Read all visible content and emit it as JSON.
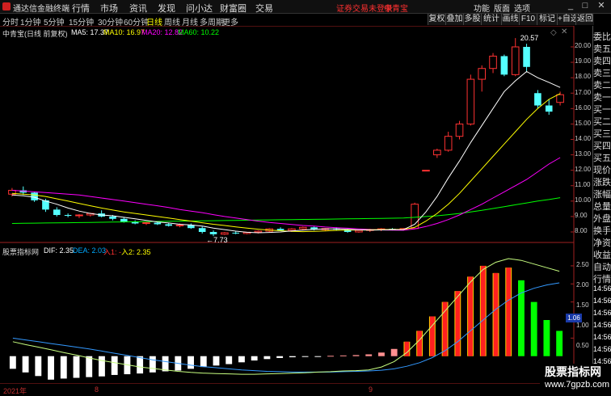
{
  "titlebar": {
    "app_title": "通达信金融终端",
    "menus": [
      "行情",
      "市场",
      "资讯",
      "发现",
      "问小达",
      "财富圈",
      "交易"
    ],
    "login_notice": "证券交易未登录",
    "stock_name": "中青宝",
    "right_items": [
      "功能",
      "版面",
      "选项"
    ],
    "window_buttons": [
      "_",
      "□",
      "✕"
    ]
  },
  "toolbar": {
    "periods": [
      "分时",
      "1分钟",
      "5分钟",
      "15分钟",
      "30分钟",
      "60分钟",
      "日线",
      "周线",
      "月线",
      "多周期",
      "更多"
    ],
    "active_period": "日线",
    "right_buttons": [
      "复权",
      "叠加",
      "多股",
      "统计",
      "画线",
      "F10",
      "标记",
      "+自选",
      "返回"
    ]
  },
  "main_chart": {
    "header_name": "中青宝(日线 前复权)",
    "ma_labels": [
      {
        "text": "MA5: 17.37",
        "color": "#ffffff"
      },
      {
        "text": "MA10: 16.97",
        "color": "#ffff00"
      },
      {
        "text": "MA20: 12.82",
        "color": "#ff00ff"
      },
      {
        "text": "MA60: 10.22",
        "color": "#00ff00"
      }
    ],
    "high_marker": "20.57",
    "low_marker": "7.73",
    "price_ticks": [
      "20.00",
      "19.00",
      "18.00",
      "17.00",
      "16.00",
      "15.00",
      "14.00",
      "13.00",
      "12.00",
      "11.00",
      "10.00",
      "9.00",
      "8.00"
    ],
    "candles": [
      [
        10.45,
        10.85,
        10.3,
        10.7
      ],
      [
        10.7,
        10.95,
        10.4,
        10.55
      ],
      [
        10.55,
        10.6,
        9.95,
        10.05
      ],
      [
        10.05,
        10.15,
        9.3,
        9.45
      ],
      [
        9.45,
        9.6,
        9.0,
        9.1
      ],
      [
        9.1,
        9.2,
        8.95,
        9.05
      ],
      [
        9.05,
        9.15,
        8.9,
        9.1
      ],
      [
        9.1,
        9.25,
        9.0,
        9.2
      ],
      [
        9.2,
        9.4,
        8.95,
        9.0
      ],
      [
        9.0,
        9.1,
        8.75,
        8.85
      ],
      [
        8.85,
        8.95,
        8.6,
        8.65
      ],
      [
        8.65,
        8.75,
        8.5,
        8.55
      ],
      [
        8.55,
        8.65,
        8.45,
        8.6
      ],
      [
        8.6,
        8.7,
        8.45,
        8.5
      ],
      [
        8.5,
        8.6,
        8.35,
        8.4
      ],
      [
        8.4,
        8.55,
        8.3,
        8.45
      ],
      [
        8.45,
        8.55,
        8.2,
        8.25
      ],
      [
        8.25,
        8.35,
        7.9,
        8.0
      ],
      [
        8.0,
        8.1,
        7.73,
        7.85
      ],
      [
        7.85,
        8.0,
        7.8,
        7.95
      ],
      [
        7.95,
        8.05,
        7.85,
        7.9
      ],
      [
        7.9,
        8.0,
        7.85,
        7.98
      ],
      [
        7.98,
        8.1,
        7.9,
        8.05
      ],
      [
        8.05,
        8.25,
        8.0,
        8.2
      ],
      [
        8.2,
        8.3,
        8.05,
        8.1
      ],
      [
        8.1,
        8.25,
        8.0,
        8.2
      ],
      [
        8.2,
        8.35,
        8.1,
        8.3
      ],
      [
        8.3,
        8.35,
        8.1,
        8.15
      ],
      [
        8.15,
        8.25,
        8.05,
        8.22
      ],
      [
        8.22,
        8.3,
        8.1,
        8.15
      ],
      [
        8.15,
        8.2,
        7.95,
        8.0
      ],
      [
        8.0,
        8.15,
        7.95,
        8.1
      ],
      [
        8.1,
        8.2,
        8.0,
        8.15
      ],
      [
        8.15,
        8.25,
        8.05,
        8.2
      ],
      [
        8.2,
        8.25,
        8.1,
        8.15
      ],
      [
        8.15,
        8.25,
        8.1,
        8.22
      ],
      [
        8.22,
        9.9,
        8.2,
        9.8
      ],
      [
        12.0,
        12.0,
        12.0,
        12.0
      ],
      [
        13.0,
        13.4,
        12.8,
        13.3
      ],
      [
        13.3,
        14.5,
        13.2,
        14.2
      ],
      [
        14.2,
        15.2,
        14.0,
        15.0
      ],
      [
        15.0,
        18.2,
        14.9,
        17.9
      ],
      [
        17.9,
        18.8,
        17.1,
        18.6
      ],
      [
        18.6,
        19.6,
        18.3,
        19.4
      ],
      [
        19.4,
        19.5,
        18.1,
        18.2
      ],
      [
        18.2,
        20.57,
        18.1,
        20.0
      ],
      [
        20.0,
        20.2,
        18.4,
        18.7
      ],
      [
        17.0,
        17.2,
        16.0,
        16.2
      ],
      [
        16.2,
        16.6,
        15.6,
        15.8
      ],
      [
        16.4,
        17.1,
        16.2,
        16.9
      ]
    ],
    "ma5": [
      10.4,
      10.35,
      10.25,
      10.0,
      9.8,
      9.55,
      9.35,
      9.2,
      9.1,
      9.05,
      8.95,
      8.85,
      8.75,
      8.65,
      8.58,
      8.5,
      8.45,
      8.38,
      8.25,
      8.15,
      8.05,
      7.98,
      7.95,
      7.97,
      8.0,
      8.07,
      8.12,
      8.17,
      8.2,
      8.2,
      8.17,
      8.13,
      8.12,
      8.13,
      8.14,
      8.15,
      8.5,
      9.3,
      10.3,
      11.5,
      12.6,
      13.8,
      14.9,
      16.0,
      17.1,
      17.8,
      18.4,
      18.0,
      17.7,
      17.37
    ],
    "ma10": [
      10.5,
      10.45,
      10.4,
      10.3,
      10.15,
      10.0,
      9.85,
      9.7,
      9.55,
      9.42,
      9.3,
      9.2,
      9.1,
      9.0,
      8.9,
      8.8,
      8.7,
      8.6,
      8.5,
      8.42,
      8.33,
      8.25,
      8.18,
      8.12,
      8.08,
      8.04,
      8.02,
      8.04,
      8.07,
      8.1,
      8.12,
      8.13,
      8.14,
      8.15,
      8.16,
      8.16,
      8.3,
      8.7,
      9.2,
      9.8,
      10.5,
      11.3,
      12.1,
      12.9,
      13.7,
      14.5,
      15.3,
      16.0,
      16.6,
      16.97
    ],
    "ma20": [
      10.7,
      10.65,
      10.6,
      10.55,
      10.5,
      10.45,
      10.4,
      10.3,
      10.2,
      10.1,
      10.0,
      9.9,
      9.8,
      9.7,
      9.58,
      9.45,
      9.35,
      9.25,
      9.12,
      9.0,
      8.9,
      8.8,
      8.7,
      8.62,
      8.55,
      8.48,
      8.42,
      8.38,
      8.32,
      8.28,
      8.24,
      8.2,
      8.16,
      8.13,
      8.12,
      8.11,
      8.2,
      8.35,
      8.55,
      8.8,
      9.1,
      9.45,
      9.8,
      10.2,
      10.6,
      11.0,
      11.4,
      11.9,
      12.4,
      12.82
    ],
    "ma60": [
      8.55,
      8.56,
      8.57,
      8.58,
      8.59,
      8.6,
      8.61,
      8.62,
      8.63,
      8.64,
      8.65,
      8.66,
      8.67,
      8.68,
      8.69,
      8.7,
      8.71,
      8.72,
      8.73,
      8.74,
      8.75,
      8.76,
      8.77,
      8.78,
      8.79,
      8.8,
      8.81,
      8.82,
      8.83,
      8.84,
      8.85,
      8.86,
      8.87,
      8.88,
      8.89,
      8.9,
      8.95,
      9.0,
      9.05,
      9.12,
      9.2,
      9.3,
      9.4,
      9.52,
      9.64,
      9.76,
      9.88,
      10.0,
      10.1,
      10.22
    ]
  },
  "macd_panel": {
    "title": "股票指标网",
    "labels": [
      {
        "text": "DIF: 2.35",
        "color": "#ffffff"
      },
      {
        "text": "DEA: 2.03",
        "color": "#00aaff"
      },
      {
        "text": "入1: -",
        "color": "#ff3030"
      },
      {
        "text": "入2: 2.35",
        "color": "#ffff00"
      }
    ],
    "ticks": [
      "2.50",
      "2.00",
      "1.50",
      "1.00",
      "0.50"
    ],
    "current_value": "1.06",
    "bars": [
      -0.35,
      -0.45,
      -0.55,
      -0.65,
      -0.62,
      -0.6,
      -0.58,
      -0.56,
      -0.52,
      -0.5,
      -0.48,
      -0.45,
      -0.42,
      -0.4,
      -0.35,
      -0.3,
      -0.26,
      -0.22,
      -0.17,
      -0.12,
      -0.08,
      -0.05,
      -0.03,
      -0.02,
      -0.01,
      0.01,
      0.02,
      0.03,
      0.05,
      0.1,
      0.2,
      0.4,
      0.7,
      1.1,
      1.5,
      1.8,
      2.2,
      2.5,
      2.3,
      2.45,
      2.1,
      1.5,
      1.0,
      0.7
    ],
    "dif": [
      0.4,
      0.32,
      0.25,
      0.18,
      0.1,
      0.03,
      -0.05,
      -0.12,
      -0.18,
      -0.24,
      -0.3,
      -0.34,
      -0.38,
      -0.42,
      -0.45,
      -0.47,
      -0.48,
      -0.49,
      -0.5,
      -0.5,
      -0.49,
      -0.48,
      -0.47,
      -0.46,
      -0.44,
      -0.43,
      -0.41,
      -0.4,
      -0.38,
      -0.3,
      -0.15,
      0.1,
      0.45,
      0.85,
      1.25,
      1.65,
      2.05,
      2.4,
      2.6,
      2.7,
      2.65,
      2.55,
      2.45,
      2.35
    ],
    "dea": [
      0.5,
      0.45,
      0.4,
      0.35,
      0.3,
      0.25,
      0.2,
      0.14,
      0.08,
      0.02,
      -0.04,
      -0.1,
      -0.15,
      -0.2,
      -0.25,
      -0.29,
      -0.32,
      -0.35,
      -0.38,
      -0.4,
      -0.42,
      -0.43,
      -0.44,
      -0.44,
      -0.44,
      -0.44,
      -0.43,
      -0.42,
      -0.41,
      -0.39,
      -0.35,
      -0.28,
      -0.18,
      -0.04,
      0.15,
      0.4,
      0.7,
      1.0,
      1.3,
      1.55,
      1.75,
      1.88,
      1.97,
      2.03
    ]
  },
  "sidebar": {
    "items": [
      "委比",
      "卖五",
      "卖四",
      "卖三",
      "卖二",
      "卖一",
      "买一",
      "买二",
      "买三",
      "买四",
      "买五",
      "现价",
      "涨跌",
      "涨幅",
      "总量",
      "外盘",
      "换手",
      "净资",
      "收益"
    ],
    "lower_items": [
      "自动",
      "行情"
    ],
    "times": [
      "14:56",
      "14:56",
      "14:56",
      "14:56",
      "14:56",
      "14:56",
      "14:56",
      "14:56",
      "14:56"
    ]
  },
  "x_axis": {
    "labels": [
      "2021年",
      "8",
      "9"
    ]
  },
  "watermark": {
    "line1": "股票指标网",
    "line2": "www.7gpzb.com"
  },
  "colors": {
    "up": "#ff3232",
    "down": "#54ffff",
    "ma5": "#ffffff",
    "ma10": "#ffff00",
    "ma20": "#ff00ff",
    "ma60": "#00ff00",
    "dif": "#ffffff",
    "dea": "#3399ff"
  }
}
